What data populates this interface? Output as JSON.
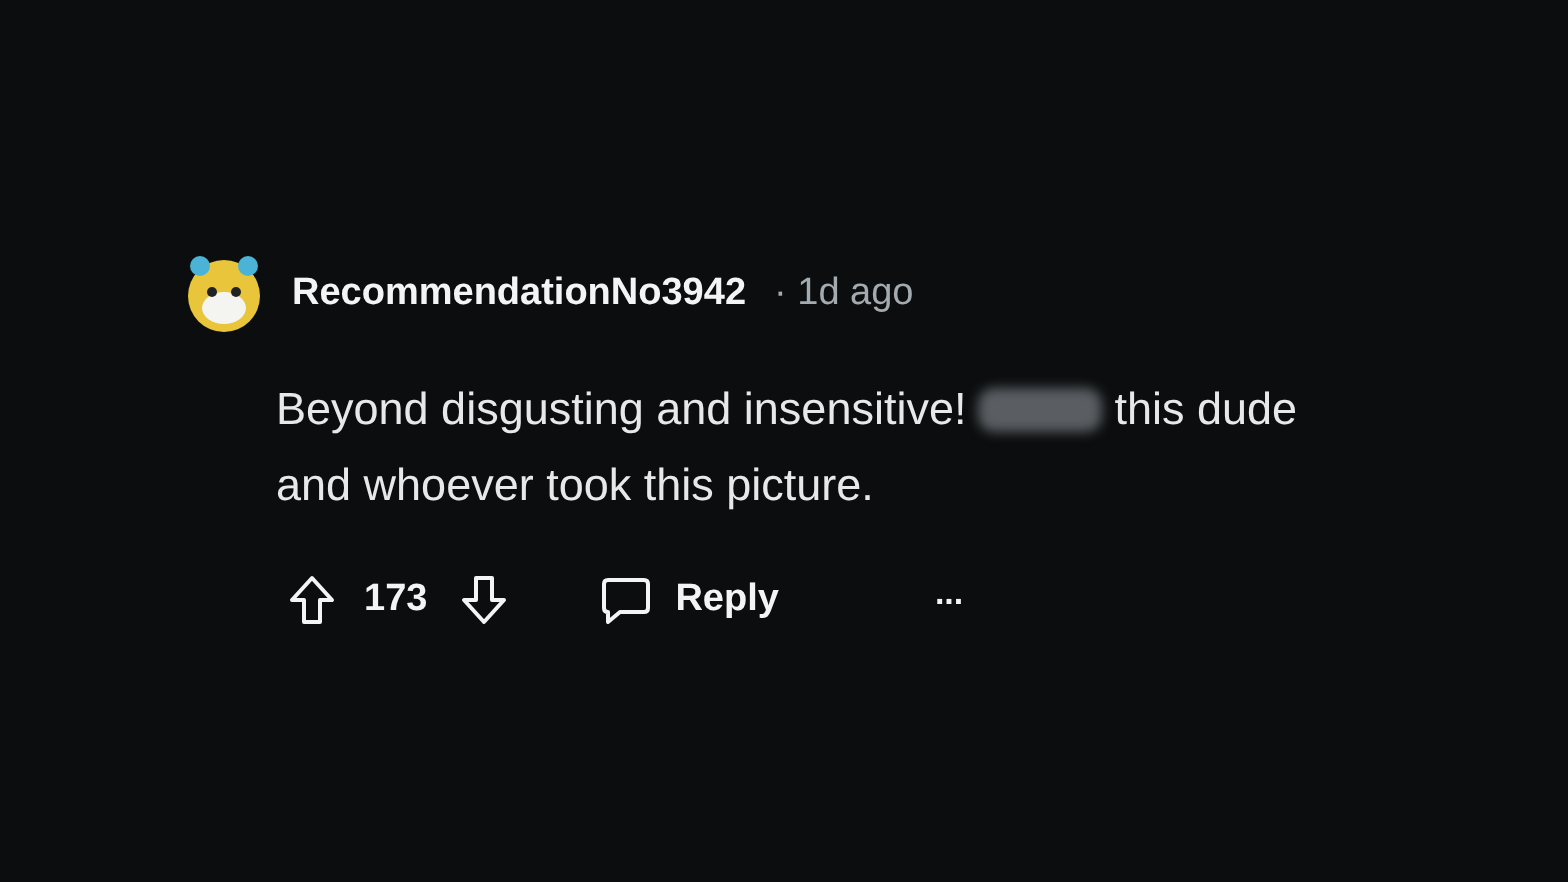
{
  "comment": {
    "author": "RecommendationNo3942",
    "separator": "·",
    "time": "1d ago",
    "body": {
      "line_1_before": "Beyond disgusting and insensitive!",
      "line_1_after": "this dude",
      "line_2": "and whoever took this picture.",
      "censored": true
    },
    "votes": "173",
    "reply": "Reply",
    "more": "..."
  }
}
